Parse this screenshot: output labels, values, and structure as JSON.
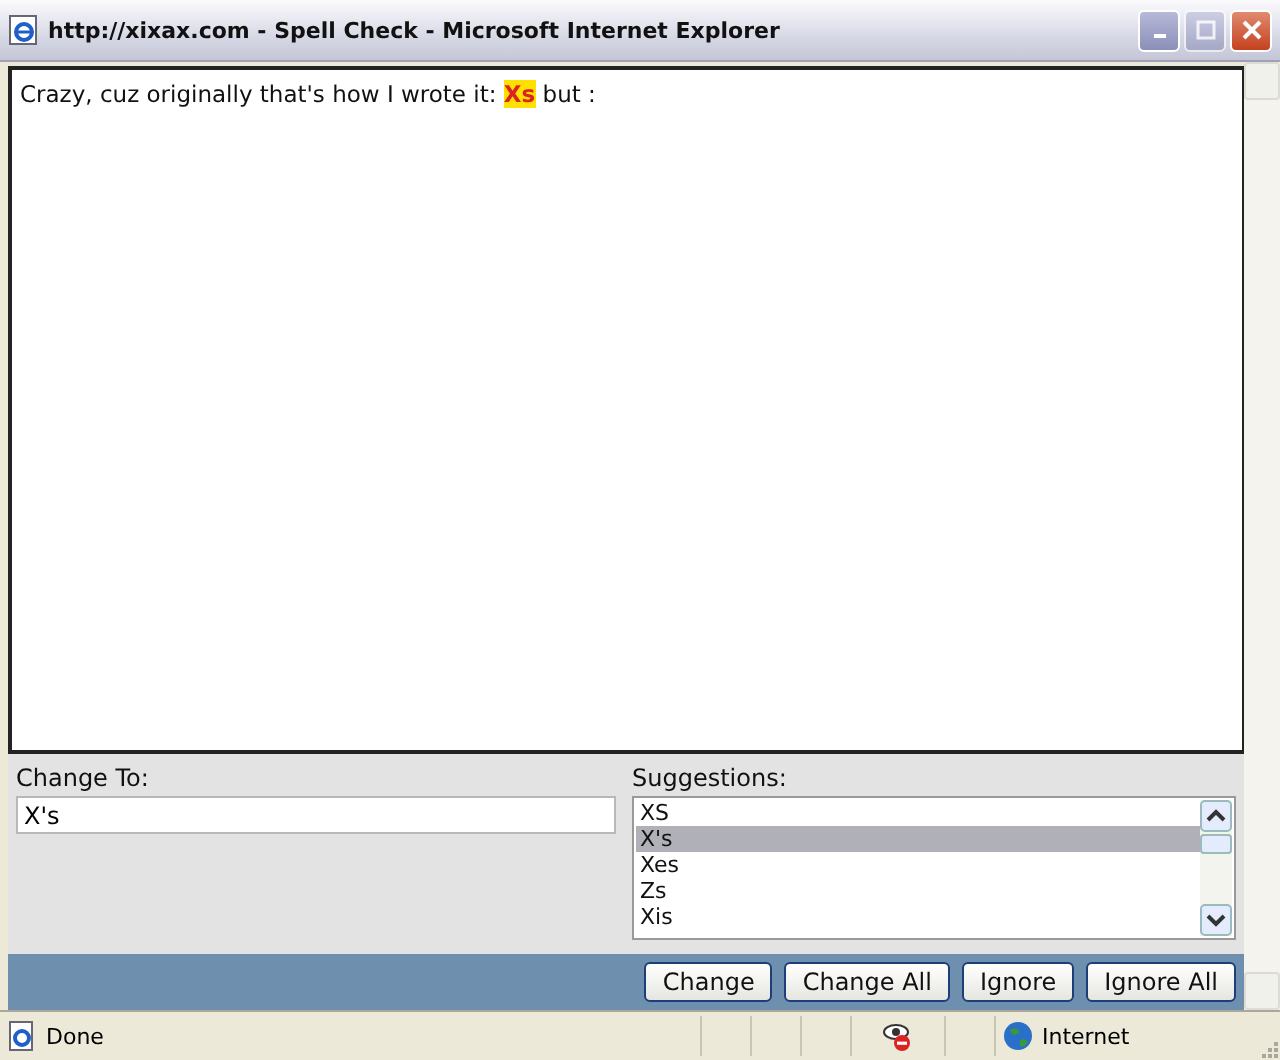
{
  "window": {
    "title": "http://xixax.com - Spell Check - Microsoft Internet Explorer"
  },
  "document": {
    "text_before": "Crazy, cuz originally that's how I wrote it:",
    "misspelled": "Xs",
    "text_after": "but :"
  },
  "change_to": {
    "label": "Change To:",
    "value": "X's"
  },
  "suggestions": {
    "label": "Suggestions:",
    "items": [
      {
        "text": "XS",
        "selected": false
      },
      {
        "text": "X's",
        "selected": true
      },
      {
        "text": "Xes",
        "selected": false
      },
      {
        "text": "Zs",
        "selected": false
      },
      {
        "text": "Xis",
        "selected": false
      }
    ]
  },
  "buttons": [
    "Change",
    "Change All",
    "Ignore",
    "Ignore All"
  ],
  "status_bar": {
    "text": "Done",
    "zone": "Internet"
  }
}
